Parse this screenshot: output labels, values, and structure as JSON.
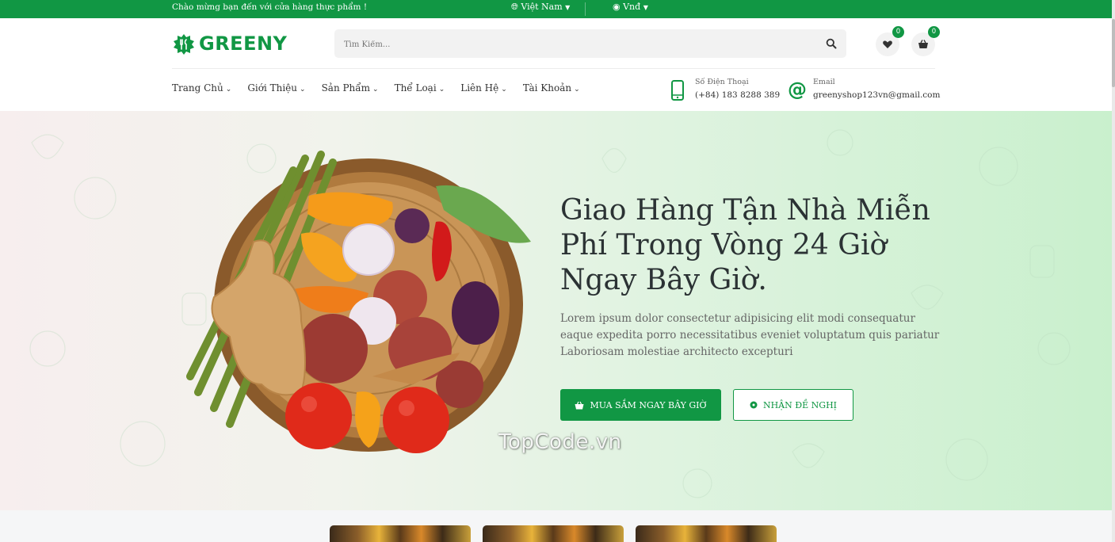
{
  "topbar": {
    "welcome": "Chào mừng bạn đến với cửa hàng thực phẩm !",
    "language": "Việt Nam",
    "currency": "Vnđ"
  },
  "header": {
    "logo_text": "GREENY",
    "search_placeholder": "Tìm Kiếm...",
    "wishlist_count": "0",
    "cart_count": "0"
  },
  "nav": {
    "items": [
      {
        "label": "Trang Chủ"
      },
      {
        "label": "Giới Thiệu"
      },
      {
        "label": "Sản Phẩm"
      },
      {
        "label": "Thể Loại"
      },
      {
        "label": "Liên Hệ"
      },
      {
        "label": "Tài Khoản"
      }
    ],
    "phone_label": "Số Điện Thoại",
    "phone_value": "(+84) 183 8288 389",
    "email_label": "Email",
    "email_value": "greenyshop123vn@gmail.com"
  },
  "hero": {
    "headline": "Giao Hàng Tận Nhà Miễn Phí Trong Vòng 24 Giờ Ngay Bây Giờ.",
    "description": "Lorem ipsum dolor consectetur adipisicing elit modi consequatur eaque expedita porro necessitatibus eveniet voluptatum quis pariatur Laboriosam molestiae architecto excepturi",
    "shop_button": "MUA SẮM NGAY BÂY GIỜ",
    "offer_button": "NHẬN ĐỀ NGHỊ"
  },
  "watermark": "TopCode.vn",
  "icons": [
    "globe-icon",
    "money-bag-icon",
    "search-icon",
    "heart-icon",
    "basket-icon",
    "phone-icon",
    "at-icon",
    "chevron-down-icon"
  ],
  "colors": {
    "brand": "#119744",
    "heading": "#2b3234"
  }
}
